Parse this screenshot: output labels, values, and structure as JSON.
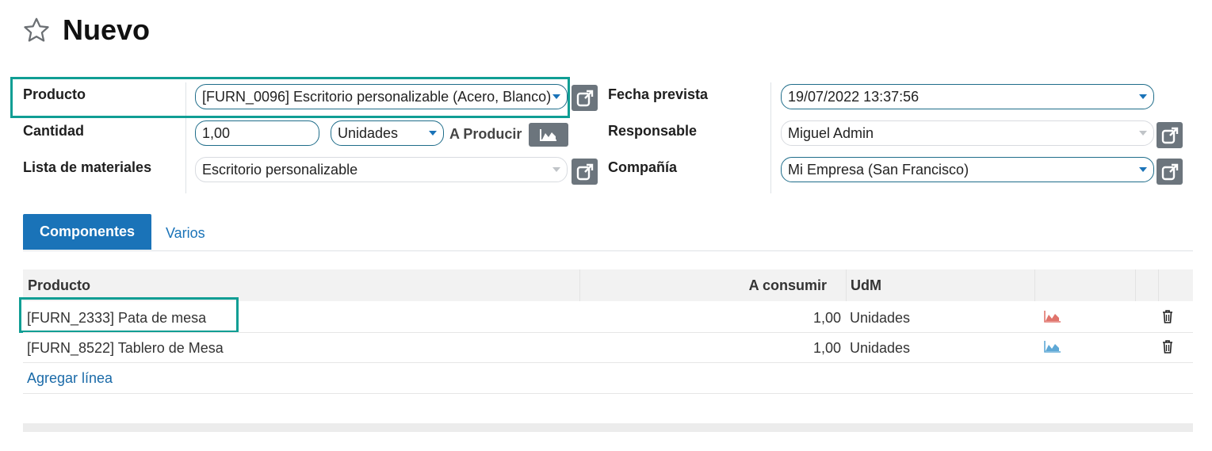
{
  "header": {
    "title": "Nuevo"
  },
  "form": {
    "product_label": "Producto",
    "product_value": "[FURN_0096] Escritorio personalizable (Acero, Blanco)",
    "quantity_label": "Cantidad",
    "quantity_value": "1,00",
    "uom_value": "Unidades",
    "to_produce_label": "A Producir",
    "bom_label": "Lista de materiales",
    "bom_value": "Escritorio personalizable",
    "date_label": "Fecha prevista",
    "date_value": "19/07/2022 13:37:56",
    "responsible_label": "Responsable",
    "responsible_value": "Miguel Admin",
    "company_label": "Compañía",
    "company_value": "Mi Empresa (San Francisco)"
  },
  "tabs": [
    {
      "label": "Componentes",
      "active": true
    },
    {
      "label": "Varios",
      "active": false
    }
  ],
  "table": {
    "headers": {
      "product": "Producto",
      "to_consume": "A consumir",
      "uom": "UdM"
    },
    "rows": [
      {
        "product": "[FURN_2333] Pata de mesa",
        "to_consume": "1,00",
        "uom": "Unidades",
        "forecast_color": "#e0746c"
      },
      {
        "product": "[FURN_8522] Tablero de Mesa",
        "to_consume": "1,00",
        "uom": "Unidades",
        "forecast_color": "#5ea8d6"
      }
    ],
    "add_line": "Agregar línea"
  },
  "colors": {
    "primary": "#1a73b8",
    "highlight": "#109e94",
    "button_grey": "#6c757d"
  }
}
